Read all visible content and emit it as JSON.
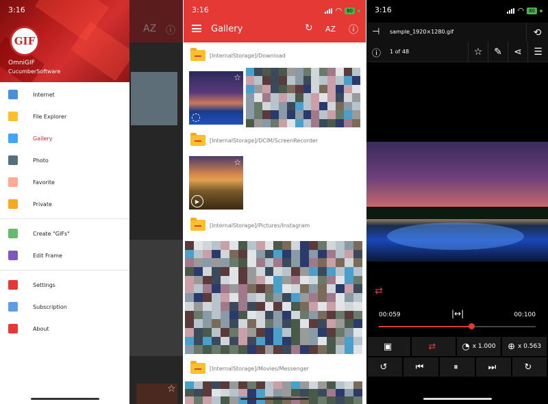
{
  "status": {
    "time": "3:16",
    "battery": "80"
  },
  "drawer": {
    "app_name": "OmniGIF",
    "company": "CucumberSoftware",
    "logo_text": "GIF",
    "items": [
      {
        "label": "Internet",
        "icon": "globe-icon",
        "color": "#4a90d9"
      },
      {
        "label": "File Explorer",
        "icon": "folder-icon",
        "color": "#fbc02d"
      },
      {
        "label": "Gallery",
        "icon": "gallery-icon",
        "color": "#42a5f5"
      },
      {
        "label": "Photo",
        "icon": "camera-icon",
        "color": "#546e7a"
      },
      {
        "label": "Favorite",
        "icon": "tag-icon",
        "color": "#ffab91"
      },
      {
        "label": "Private",
        "icon": "lock-icon",
        "color": "#f9a825"
      },
      {
        "label": "Create \"GIFs\"",
        "icon": "create-icon",
        "color": "#66bb6a"
      },
      {
        "label": "Edit Frame",
        "icon": "edit-frame-icon",
        "color": "#7e57c2"
      },
      {
        "label": "Settings",
        "icon": "gear-icon",
        "color": "#e53935"
      },
      {
        "label": "Subscription",
        "icon": "subscription-icon",
        "color": "#5c9ee0"
      },
      {
        "label": "About",
        "icon": "info-icon",
        "color": "#e53935"
      }
    ],
    "active_index": 2
  },
  "gallery": {
    "title": "Gallery",
    "folders": [
      "[InternalStorage]/Download",
      "[InternalStorage]/DCIM/ScreenRecorder",
      "[InternalStorage]/Pictures/Instagram",
      "[InternalStorage]/Movies/Messenger"
    ]
  },
  "viewer": {
    "filename": "sample_1920×1280.gif",
    "counter": "1 of 48",
    "time_start": "00:059",
    "time_end": "00:100",
    "progress": 0.59,
    "speed": "x 1.000",
    "zoom": "x 0.563"
  },
  "colors": {
    "accent": "#e53935",
    "background_dark": "#000000"
  }
}
